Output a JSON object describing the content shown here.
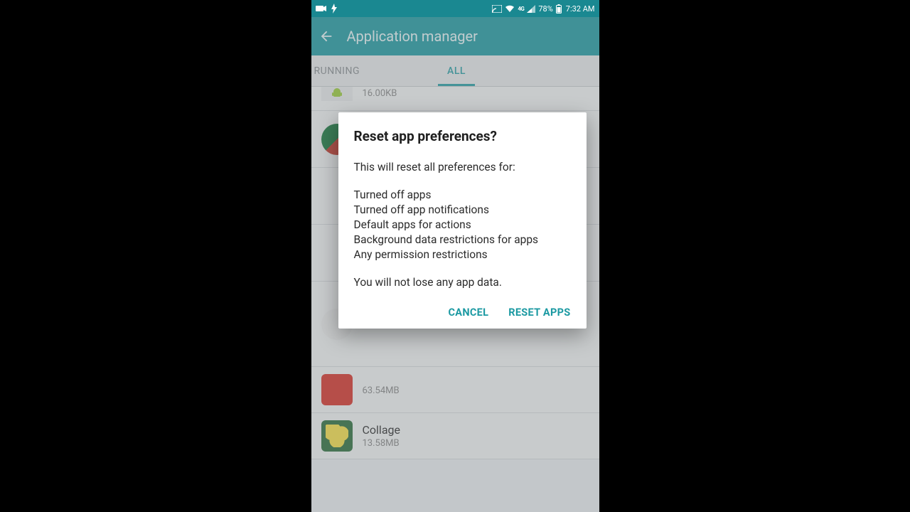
{
  "status": {
    "battery_pct": "78%",
    "time": "7:32 AM"
  },
  "appbar": {
    "title": "Application manager"
  },
  "tabs": {
    "running": "RUNNING",
    "all": "ALL"
  },
  "list": {
    "top_partial_size": "16.00KB",
    "row_red": {
      "name": "",
      "size": "63.54MB"
    },
    "row_collage": {
      "name": "Collage",
      "size": "13.58MB"
    }
  },
  "dialog": {
    "title": "Reset app preferences?",
    "intro": "This will reset all preferences for:",
    "items": [
      "Turned off apps",
      "Turned off app notifications",
      "Default apps for actions",
      "Background data restrictions for apps",
      "Any permission restrictions"
    ],
    "footer": "You will not lose any app data.",
    "cancel": "CANCEL",
    "confirm": "RESET APPS"
  }
}
